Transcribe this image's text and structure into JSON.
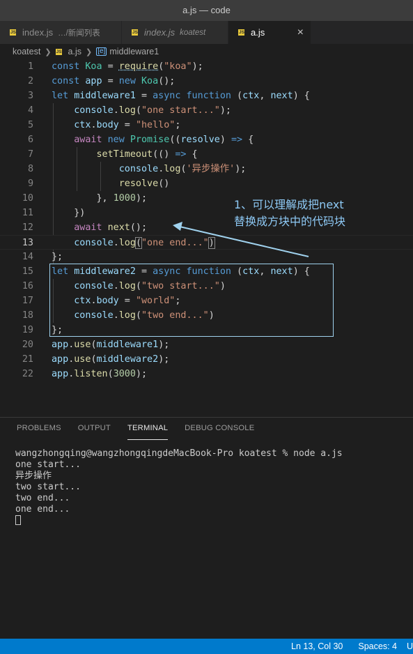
{
  "window": {
    "title": "a.js — code"
  },
  "tabs": [
    {
      "name": "index.js",
      "desc": "…/新闻列表",
      "italic": false,
      "active": false
    },
    {
      "name": "index.js",
      "desc": "koatest",
      "italic": true,
      "active": false
    },
    {
      "name": "a.js",
      "desc": "",
      "italic": false,
      "active": true
    }
  ],
  "icons": {
    "js_icon_label": "JS",
    "close_glyph": "×",
    "symbol_glyph": "[e]"
  },
  "breadcrumb": {
    "folder": "koatest",
    "file": "a.js",
    "symbol": "middleware1"
  },
  "code_lines": [
    {
      "n": "1"
    },
    {
      "n": "2"
    },
    {
      "n": "3"
    },
    {
      "n": "4"
    },
    {
      "n": "5"
    },
    {
      "n": "6"
    },
    {
      "n": "7"
    },
    {
      "n": "8"
    },
    {
      "n": "9"
    },
    {
      "n": "10"
    },
    {
      "n": "11"
    },
    {
      "n": "12"
    },
    {
      "n": "13"
    },
    {
      "n": "14"
    },
    {
      "n": "15"
    },
    {
      "n": "16"
    },
    {
      "n": "17"
    },
    {
      "n": "18"
    },
    {
      "n": "19"
    },
    {
      "n": "20"
    },
    {
      "n": "21"
    },
    {
      "n": "22"
    }
  ],
  "code": {
    "l1": {
      "kw": "const",
      "id": "Koa",
      "fn": "require",
      "str": "\"koa\""
    },
    "l2": {
      "kw": "const",
      "id": "app",
      "kw2": "new",
      "cls": "Koa"
    },
    "l3": {
      "kw": "let",
      "id": "middleware1",
      "kw2": "async",
      "kw3": "function",
      "p1": "ctx",
      "p2": "next"
    },
    "l4": {
      "obj": "console",
      "fn": "log",
      "str": "\"one start...\""
    },
    "l5": {
      "obj": "ctx",
      "prop": "body",
      "str": "\"hello\""
    },
    "l6": {
      "kw": "await",
      "kw2": "new",
      "cls": "Promise",
      "p": "resolve"
    },
    "l7": {
      "fn": "setTimeout"
    },
    "l8": {
      "obj": "console",
      "fn": "log",
      "str": "'异步操作'"
    },
    "l9": {
      "fn": "resolve"
    },
    "l10": {
      "num": "1000"
    },
    "l12": {
      "kw": "await",
      "fn": "next"
    },
    "l13": {
      "obj": "console",
      "fn": "log",
      "str": "\"one end...\""
    },
    "l15": {
      "kw": "let",
      "id": "middleware2",
      "kw2": "async",
      "kw3": "function",
      "p1": "ctx",
      "p2": "next"
    },
    "l16": {
      "obj": "console",
      "fn": "log",
      "str": "\"two start...\""
    },
    "l17": {
      "obj": "ctx",
      "prop": "body",
      "str": "\"world\""
    },
    "l18": {
      "obj": "console",
      "fn": "log",
      "str": "\"two end...\""
    },
    "l20": {
      "obj": "app",
      "fn": "use",
      "arg": "middleware1"
    },
    "l21": {
      "obj": "app",
      "fn": "use",
      "arg": "middleware2"
    },
    "l22": {
      "obj": "app",
      "fn": "listen",
      "num": "3000"
    }
  },
  "annotation": {
    "line1": "1、可以理解成把next",
    "line2": "替换成方块中的代码块"
  },
  "panel": {
    "tabs": [
      "PROBLEMS",
      "OUTPUT",
      "TERMINAL",
      "DEBUG CONSOLE"
    ],
    "active_tab": "TERMINAL",
    "terminal_lines": [
      "wangzhongqing@wangzhongqingdeMacBook-Pro koatest % node a.js",
      "one start...",
      "异步操作",
      "two start...",
      "two end...",
      "one end..."
    ]
  },
  "status": {
    "position": "Ln 13, Col 30",
    "spaces": "Spaces: 4",
    "encoding_truncated": "U"
  },
  "colors": {
    "statusbar": "#007acc",
    "annotation": "#8ec9f5",
    "box": "#a0d2ee",
    "js_icon": "#e8c93b"
  }
}
